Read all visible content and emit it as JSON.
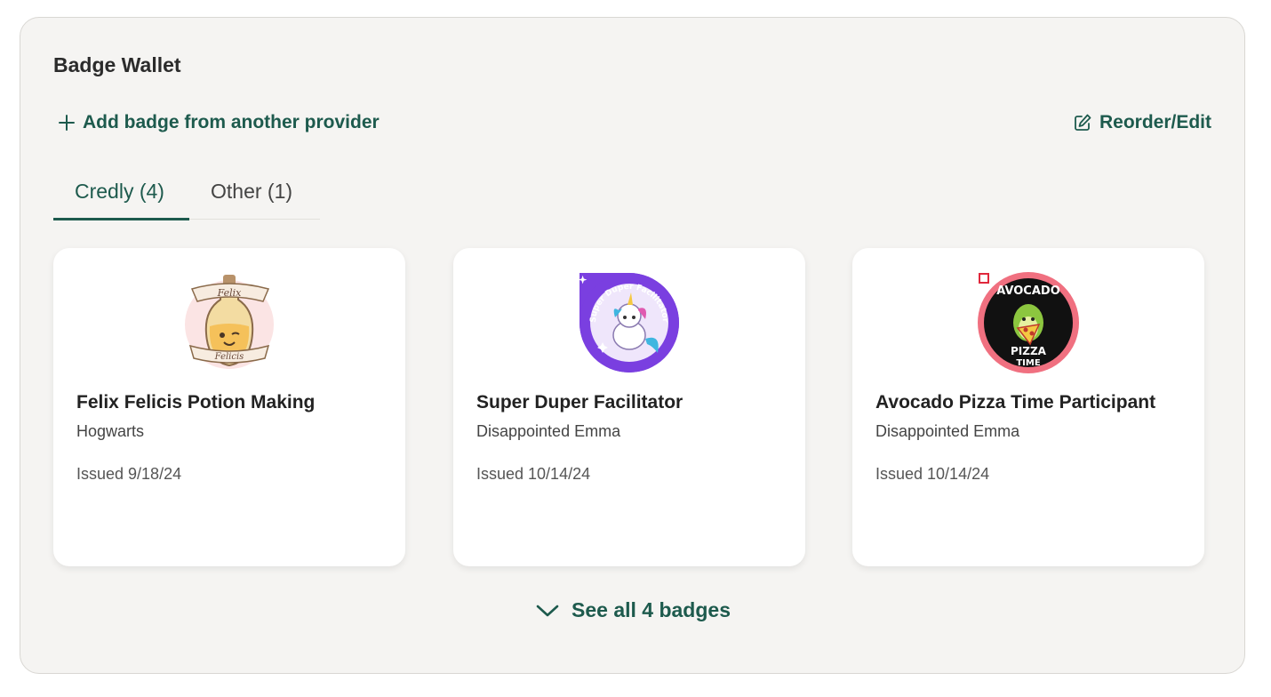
{
  "wallet": {
    "title": "Badge Wallet",
    "add_label": "Add badge from another provider",
    "reorder_label": "Reorder/Edit",
    "see_all_label": "See all 4 badges"
  },
  "tabs": [
    {
      "label": "Credly (4)",
      "active": true
    },
    {
      "label": "Other (1)",
      "active": false
    }
  ],
  "badges": [
    {
      "name": "Felix Felicis Potion Making",
      "issuer": "Hogwarts",
      "issued": "Issued 9/18/24",
      "image": "felix-felicis-potion-badge"
    },
    {
      "name": "Super Duper Facilitator",
      "issuer": "Disappointed Emma",
      "issued": "Issued 10/14/24",
      "image": "unicorn-facilitator-badge"
    },
    {
      "name": "Avocado Pizza Time Participant",
      "issuer": "Disappointed Emma",
      "issued": "Issued 10/14/24",
      "image": "avocado-pizza-badge"
    }
  ],
  "badge_art": {
    "felix_banner_top": "Felix",
    "felix_banner_bottom": "Felicis",
    "unicorn_ring_text": "Super Duper Facilitator",
    "avocado_top": "AVOCADO",
    "avocado_bottom_1": "PIZZA",
    "avocado_bottom_2": "TIME"
  },
  "colors": {
    "accent": "#1d5a4d",
    "panel_bg": "#f5f4f2",
    "card_bg": "#ffffff"
  }
}
